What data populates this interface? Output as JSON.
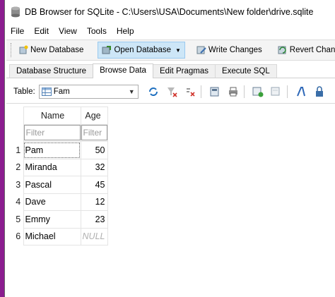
{
  "window": {
    "title": "DB Browser for SQLite - C:\\Users\\USA\\Documents\\New folder\\drive.sqlite"
  },
  "menu": [
    "File",
    "Edit",
    "View",
    "Tools",
    "Help"
  ],
  "toolbar": {
    "new_database": "New Database",
    "open_database": "Open Database",
    "write_changes": "Write Changes",
    "revert_changes": "Revert Changes"
  },
  "tabs": [
    "Database Structure",
    "Browse Data",
    "Edit Pragmas",
    "Execute SQL"
  ],
  "browse": {
    "table_label": "Table:",
    "table_selected": "Fam"
  },
  "grid": {
    "columns": [
      "Name",
      "Age"
    ],
    "filter_placeholder": "Filter",
    "rows": [
      {
        "num": "1",
        "name": "Pam",
        "age": "50"
      },
      {
        "num": "2",
        "name": "Miranda",
        "age": "32"
      },
      {
        "num": "3",
        "name": "Pascal",
        "age": "45"
      },
      {
        "num": "4",
        "name": "Dave",
        "age": "12"
      },
      {
        "num": "5",
        "name": "Emmy",
        "age": "23"
      },
      {
        "num": "6",
        "name": "Michael",
        "age": "NULL"
      }
    ]
  },
  "colors": {
    "background": "#8b1d8f",
    "active_button": "#cde6f7"
  }
}
